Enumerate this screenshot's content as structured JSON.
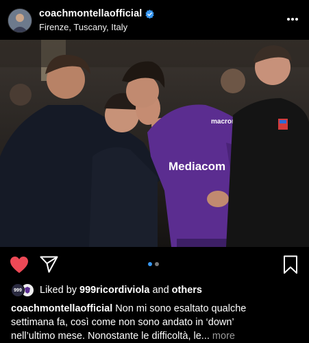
{
  "post": {
    "username": "coachmontellaofficial",
    "location": "Firenze, Tuscany, Italy",
    "photo": {
      "jersey_sponsor_text": "Mediacom",
      "jersey_brand": "macron"
    }
  },
  "likes": {
    "prefix": "Liked by",
    "user": "999ricordiviola",
    "connector": "and",
    "others": "others",
    "avatar_text": "999"
  },
  "caption": {
    "username": "coachmontellaofficial",
    "line1": "Non mi sono esaltato qualche",
    "line2": "settimana fa, così come non sono andato in ‘down’",
    "line3": "nell’ultimo mese. Nonostante le difficoltà, le...",
    "more": "more"
  },
  "carousel": {
    "current": 1,
    "total": 2
  },
  "colors": {
    "background": "#000000",
    "heart": "#ed4956",
    "verified": "#3897f0",
    "jersey": "#5b2d90",
    "active_dot": "#3897f0"
  },
  "icons": [
    "more-options-icon",
    "verified-badge-icon",
    "heart-icon",
    "share-icon",
    "bookmark-icon"
  ]
}
